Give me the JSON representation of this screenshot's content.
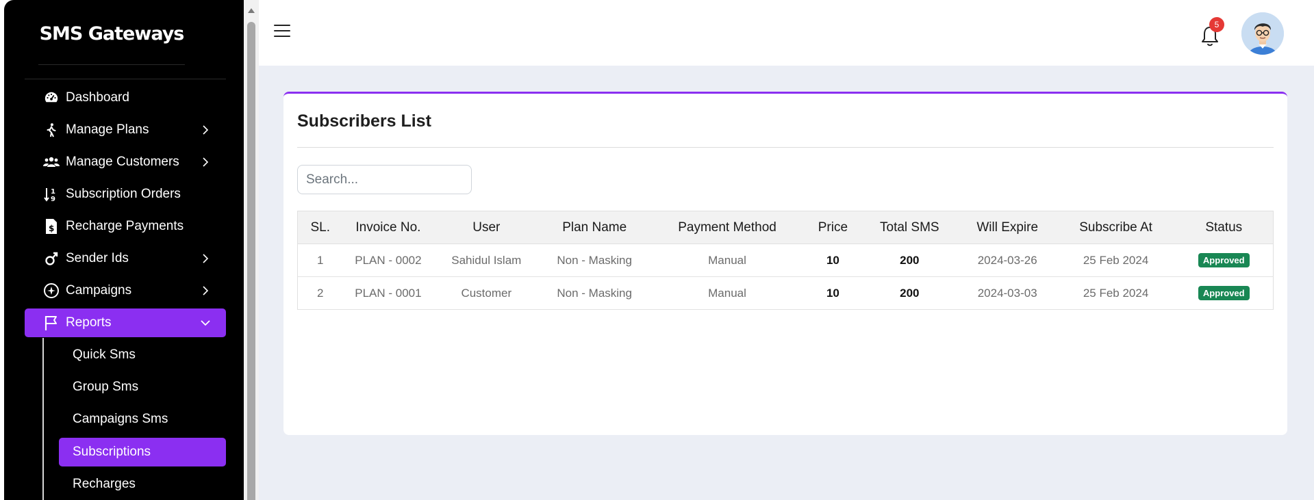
{
  "sidebar": {
    "brand": "SMS Gateways",
    "items": [
      {
        "label": "Dashboard",
        "icon": "dashboard-gauge-icon"
      },
      {
        "label": "Manage Plans",
        "icon": "walking-person-icon"
      },
      {
        "label": "Manage Customers",
        "icon": "users-icon"
      },
      {
        "label": "Subscription Orders",
        "icon": "sort-arrows-icon"
      },
      {
        "label": "Recharge Payments",
        "icon": "invoice-dollar-icon"
      },
      {
        "label": "Sender Ids",
        "icon": "genderless-icon"
      },
      {
        "label": "Campaigns",
        "icon": "campaign-icon"
      },
      {
        "label": "Reports",
        "icon": "flag-icon"
      }
    ],
    "sub_items": [
      {
        "label": "Quick Sms"
      },
      {
        "label": "Group Sms"
      },
      {
        "label": "Campaigns Sms"
      },
      {
        "label": "Subscriptions"
      },
      {
        "label": "Recharges"
      }
    ],
    "accent_color": "#8b2ff1"
  },
  "topbar": {
    "notification_count": "5"
  },
  "card": {
    "title": "Subscribers List",
    "search_placeholder": "Search..."
  },
  "table": {
    "headers": [
      "SL.",
      "Invoice No.",
      "User",
      "Plan Name",
      "Payment Method",
      "Price",
      "Total SMS",
      "Will Expire",
      "Subscribe At",
      "Status"
    ],
    "rows": [
      {
        "sl": "1",
        "invoice": "PLAN - 0002",
        "user": "Sahidul Islam",
        "plan": "Non - Masking",
        "method": "Manual",
        "price": "10",
        "sms": "200",
        "expire": "2024-03-26",
        "subscribed": "25 Feb 2024",
        "status": "Approved"
      },
      {
        "sl": "2",
        "invoice": "PLAN - 0001",
        "user": "Customer",
        "plan": "Non - Masking",
        "method": "Manual",
        "price": "10",
        "sms": "200",
        "expire": "2024-03-03",
        "subscribed": "25 Feb 2024",
        "status": "Approved"
      }
    ]
  }
}
